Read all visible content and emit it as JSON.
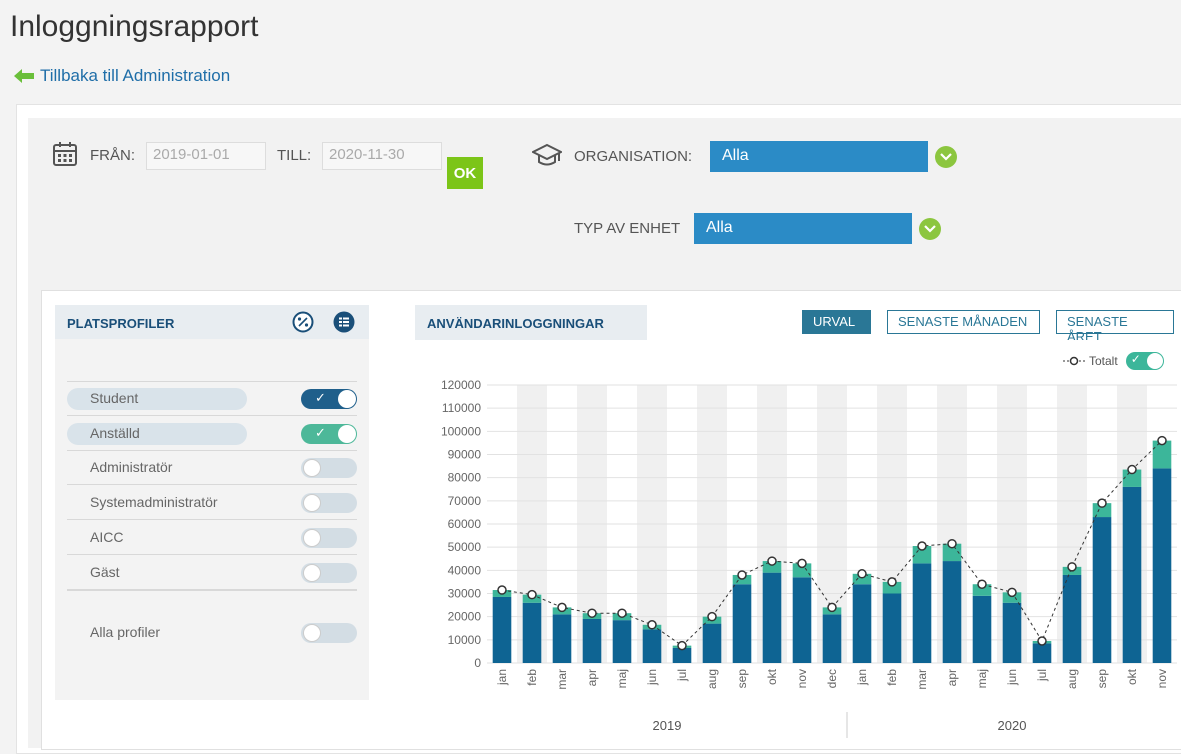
{
  "page": {
    "title": "Inloggningsrapport",
    "back_link": "Tillbaka till Administration"
  },
  "filters": {
    "from_label": "FRÅN:",
    "from_value": "2019-01-01",
    "to_label": "TILL:",
    "to_value": "2020-11-30",
    "ok_label": "OK",
    "organisation_label": "ORGANISATION:",
    "organisation_value": "Alla",
    "unit_type_label": "TYP AV ENHET",
    "unit_type_value": "Alla"
  },
  "profiles": {
    "title": "PLATSPROFILER",
    "items": [
      {
        "label": "Student",
        "on": true,
        "color": "#1f5f8b"
      },
      {
        "label": "Anställd",
        "on": true,
        "color": "#4db899"
      },
      {
        "label": "Administratör",
        "on": false
      },
      {
        "label": "Systemadministratör",
        "on": false
      },
      {
        "label": "AICC",
        "on": false
      },
      {
        "label": "Gäst",
        "on": false
      }
    ],
    "all_label": "Alla profiler",
    "all_on": false
  },
  "chart_panel": {
    "title": "ANVÄNDARINLOGGNINGAR",
    "btn_selection": "URVAL",
    "btn_last_month": "SENASTE MÅNADEN",
    "btn_last_year": "SENASTE ÅRET",
    "legend_total": "Totalt"
  },
  "colors": {
    "student": "#0e6493",
    "employee": "#3cb69a",
    "accent": "#2b8bc6",
    "ok": "#7cc518"
  },
  "chart_data": {
    "type": "bar",
    "stacked": true,
    "categories": [
      "jan",
      "feb",
      "mar",
      "apr",
      "maj",
      "jun",
      "jul",
      "aug",
      "sep",
      "okt",
      "nov",
      "dec",
      "jan",
      "feb",
      "mar",
      "apr",
      "maj",
      "jun",
      "jul",
      "aug",
      "sep",
      "okt",
      "nov"
    ],
    "groups": [
      {
        "label": "2019",
        "count": 12
      },
      {
        "label": "2020",
        "count": 11
      }
    ],
    "series": [
      {
        "name": "Student",
        "values": [
          28500,
          26000,
          21000,
          19000,
          18500,
          14500,
          6500,
          17000,
          34000,
          39000,
          37000,
          21000,
          34000,
          30000,
          43000,
          44000,
          29000,
          26000,
          8500,
          38000,
          63000,
          76000,
          84000
        ]
      },
      {
        "name": "Anställd",
        "values": [
          3000,
          3500,
          3000,
          2500,
          3000,
          2000,
          1000,
          3000,
          4000,
          5000,
          6000,
          3000,
          4500,
          5000,
          7500,
          7500,
          5000,
          4500,
          1000,
          3500,
          6000,
          7500,
          12000
        ]
      }
    ],
    "totals": [
      31500,
      29500,
      24000,
      21500,
      21500,
      16500,
      7500,
      20000,
      38000,
      44000,
      43000,
      24000,
      38500,
      35000,
      50500,
      51500,
      34000,
      30500,
      9500,
      41500,
      69000,
      83500,
      96000
    ],
    "yticks": [
      0,
      10000,
      20000,
      30000,
      40000,
      50000,
      60000,
      70000,
      80000,
      90000,
      100000,
      110000,
      120000
    ],
    "ylim": [
      0,
      120000
    ]
  }
}
